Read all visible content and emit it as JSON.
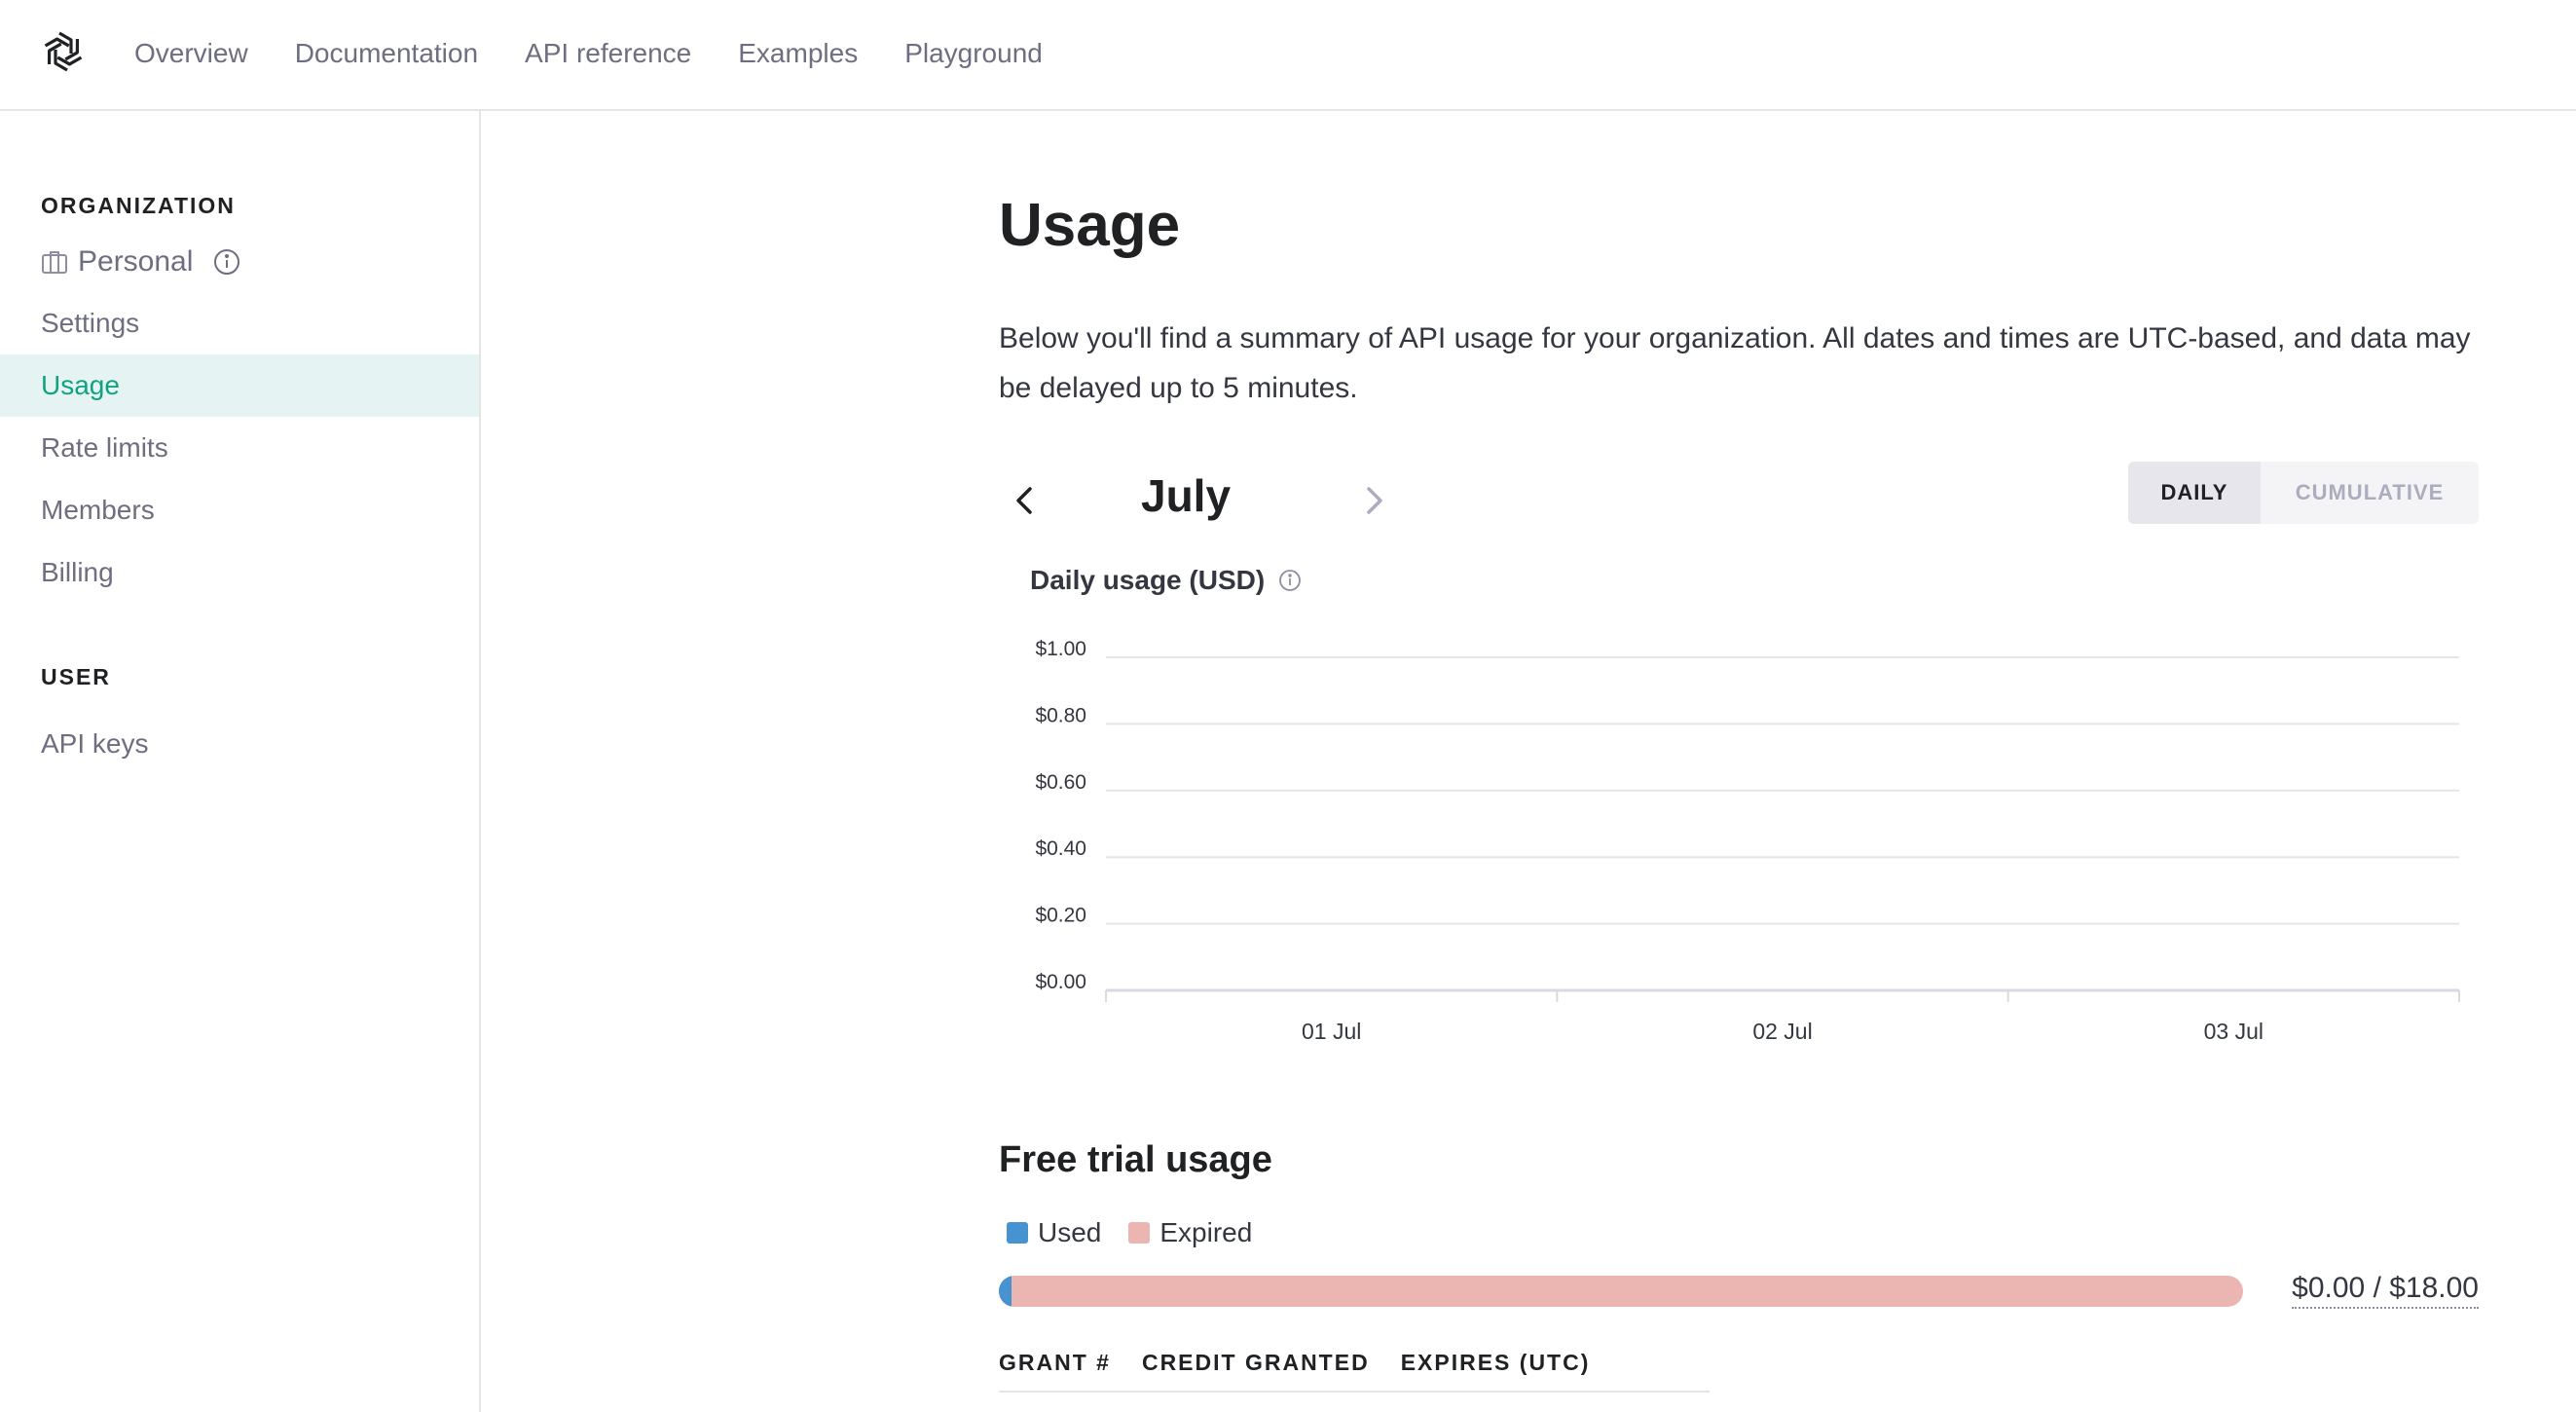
{
  "nav": {
    "logo_icon": "openai-logo-icon",
    "links": [
      "Overview",
      "Documentation",
      "API reference",
      "Examples",
      "Playground"
    ]
  },
  "sidebar": {
    "org_heading": "ORGANIZATION",
    "org_name": "Personal",
    "org_items": [
      "Settings",
      "Usage",
      "Rate limits",
      "Members",
      "Billing"
    ],
    "active_item": "Usage",
    "user_heading": "USER",
    "user_items": [
      "API keys"
    ]
  },
  "main": {
    "title": "Usage",
    "description": "Below you'll find a summary of API usage for your organization. All dates and times are UTC-based, and data may be delayed up to 5 minutes.",
    "month": "July",
    "toggle": {
      "daily": "DAILY",
      "cumulative": "CUMULATIVE",
      "selected": "DAILY"
    },
    "chart_title": "Daily usage (USD)"
  },
  "chart_data": {
    "type": "bar",
    "title": "Daily usage (USD)",
    "categories": [
      "01 Jul",
      "02 Jul",
      "03 Jul"
    ],
    "values": [
      0,
      0,
      0
    ],
    "ylim": [
      0,
      1
    ],
    "yticks": [
      "$0.00",
      "$0.20",
      "$0.40",
      "$0.60",
      "$0.80",
      "$1.00"
    ],
    "grid": true
  },
  "free_trial": {
    "title": "Free trial usage",
    "legend": [
      {
        "label": "Used",
        "color": "#4792d0"
      },
      {
        "label": "Expired",
        "color": "#ebb5b2"
      }
    ],
    "used_fraction": 0.01,
    "total_text": "$0.00 / $18.00",
    "columns": [
      "GRANT #",
      "CREDIT GRANTED",
      "EXPIRES (UTC)"
    ]
  },
  "colors": {
    "accent": "#10a37f",
    "active_bg": "#e6f3f3"
  }
}
